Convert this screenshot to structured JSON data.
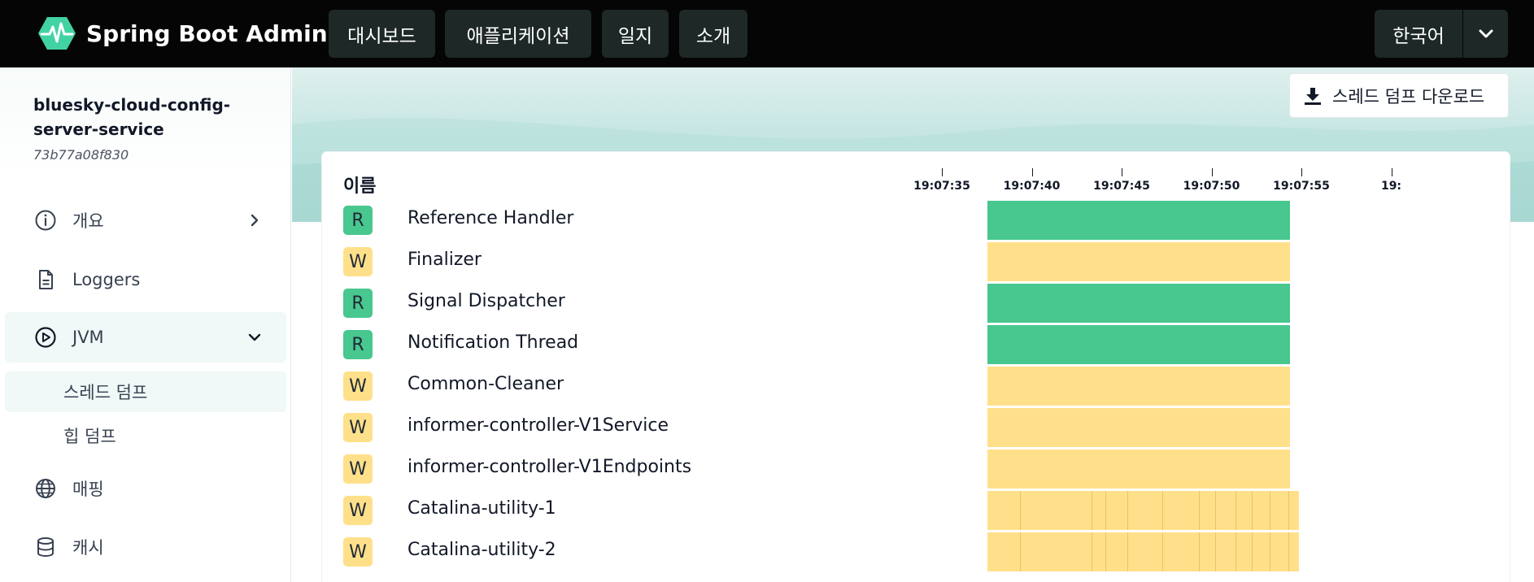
{
  "navbar": {
    "brand": "Spring Boot Admin",
    "items": [
      {
        "label": "대시보드"
      },
      {
        "label": "애플리케이션"
      },
      {
        "label": "일지"
      },
      {
        "label": "소개"
      }
    ],
    "language": "한국어"
  },
  "sidebar": {
    "app_name": "bluesky-cloud-config-server-service",
    "app_id": "73b77a08f830",
    "items": [
      {
        "label": "개요",
        "icon": "info-circle-icon"
      },
      {
        "label": "Loggers",
        "icon": "file-text-icon"
      },
      {
        "label": "JVM",
        "icon": "play-circle-icon"
      },
      {
        "label": "매핑",
        "icon": "globe-icon"
      },
      {
        "label": "캐시",
        "icon": "database-icon"
      }
    ],
    "jvm_sub": [
      {
        "label": "스레드 덤프"
      },
      {
        "label": "힙 덤프"
      }
    ]
  },
  "main": {
    "download_label": "스레드 덤프 다운로드",
    "name_header": "이름",
    "timeline": {
      "ticks": [
        "19:07:35",
        "19:07:40",
        "19:07:45",
        "19:07:50",
        "19:07:55",
        "19:"
      ]
    },
    "threads": [
      {
        "state": "R",
        "name": "Reference Handler"
      },
      {
        "state": "W",
        "name": "Finalizer"
      },
      {
        "state": "R",
        "name": "Signal Dispatcher"
      },
      {
        "state": "R",
        "name": "Notification Thread"
      },
      {
        "state": "W",
        "name": "Common-Cleaner"
      },
      {
        "state": "W",
        "name": "informer-controller-V1Service"
      },
      {
        "state": "W",
        "name": "informer-controller-V1Endpoints"
      },
      {
        "state": "W",
        "name": "Catalina-utility-1"
      },
      {
        "state": "W",
        "name": "Catalina-utility-2"
      }
    ]
  },
  "colors": {
    "runnable": "#48c78e",
    "waiting": "#ffe08a",
    "navbar": "#050505",
    "accent": "#42d3a5"
  }
}
